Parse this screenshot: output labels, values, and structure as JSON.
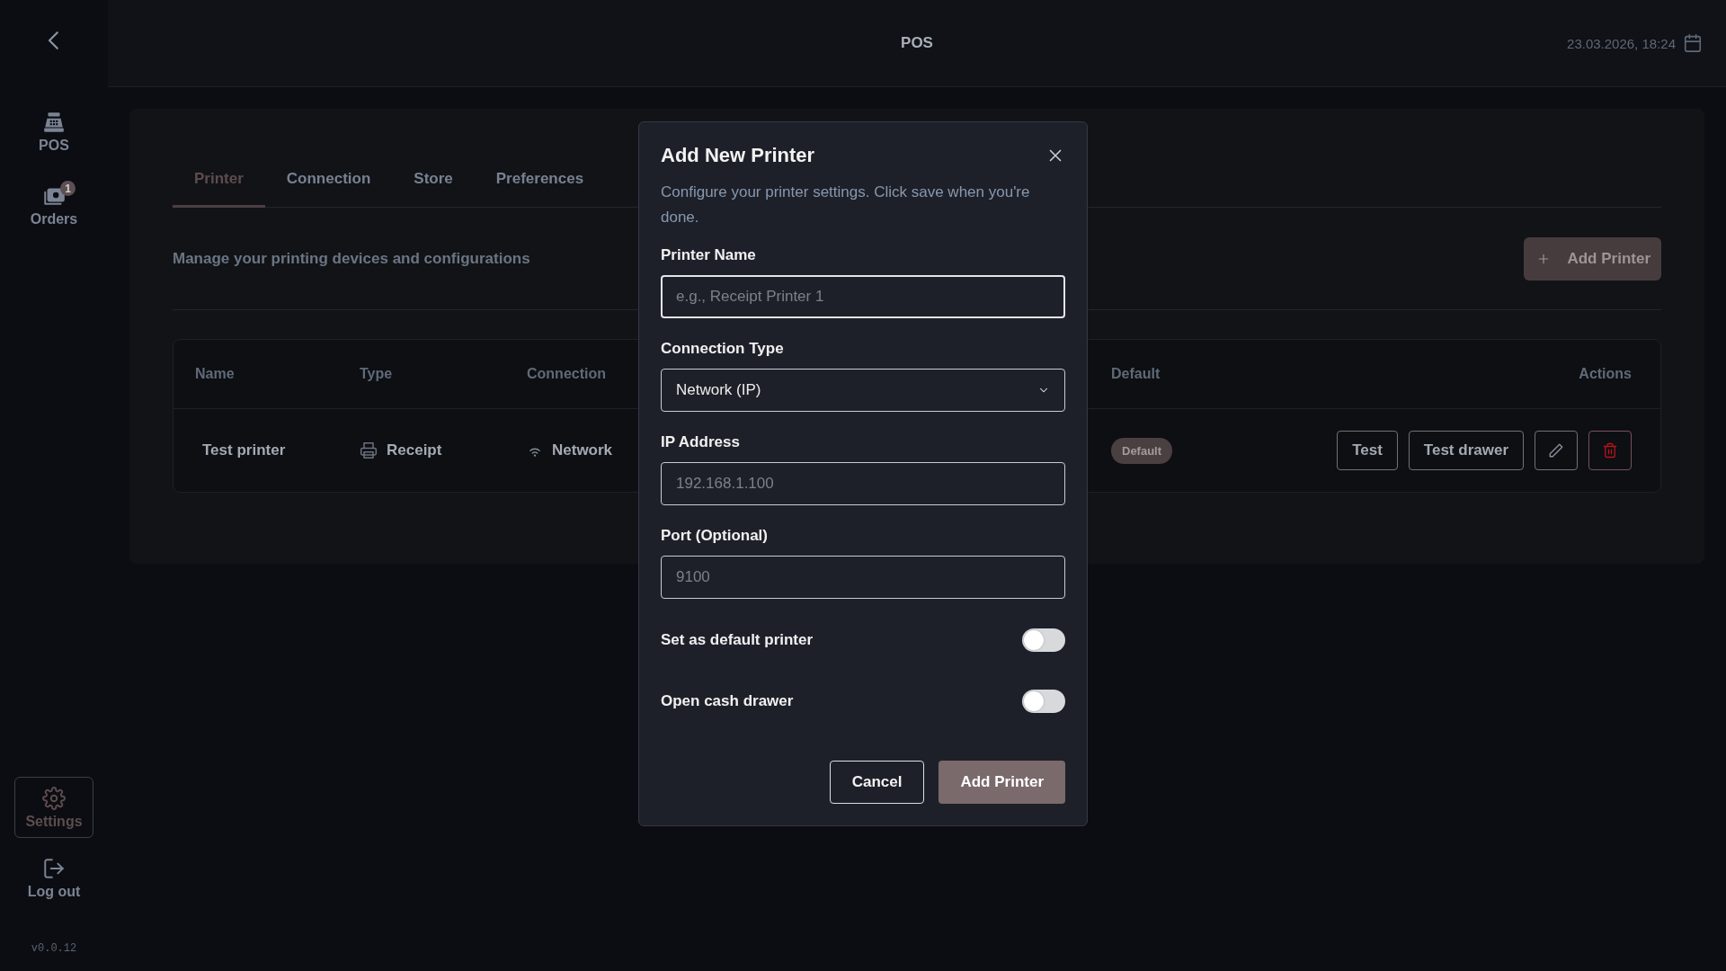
{
  "sidebar": {
    "items": [
      {
        "kind": "pos",
        "label": "POS",
        "selected": false
      },
      {
        "kind": "orders",
        "label": "Orders",
        "badge": "1",
        "selected": false
      }
    ],
    "bottom_items": [
      {
        "kind": "settings",
        "label": "Settings",
        "selected": true
      },
      {
        "kind": "logout",
        "label": "Log out",
        "selected": false
      }
    ],
    "version": "v0.0.12"
  },
  "header": {
    "title": "POS",
    "datetime": "23.03.2026, 18:24"
  },
  "tabs": [
    {
      "label": "Printer",
      "selected": true
    },
    {
      "label": "Connection",
      "selected": false
    },
    {
      "label": "Store",
      "selected": false
    },
    {
      "label": "Preferences",
      "selected": false
    }
  ],
  "description": "Manage your printing devices and configurations",
  "add_button": "Add Printer",
  "table": {
    "columns": [
      "Name",
      "Type",
      "Connection",
      "Default",
      "Actions"
    ],
    "rows": [
      {
        "name": "Test printer",
        "type": "Receipt",
        "connection": "Network",
        "default": "Default",
        "actions": [
          "Test",
          "Test drawer"
        ]
      }
    ]
  },
  "dialog": {
    "title": "Add New Printer",
    "description": "Configure your printer settings. Click save when you're done.",
    "fields": [
      {
        "kind": "text",
        "label": "Printer Name",
        "placeholder": "e.g., Receipt Printer 1",
        "focused": true
      },
      {
        "kind": "select",
        "label": "Connection Type",
        "value": "Network (IP)",
        "focused": false
      },
      {
        "kind": "text",
        "label": "IP Address",
        "placeholder": "192.168.1.100",
        "focused": false
      },
      {
        "kind": "text",
        "label": "Port (Optional)",
        "placeholder": "9100",
        "focused": false
      }
    ],
    "toggles": [
      {
        "label": "Set as default printer",
        "on": false
      },
      {
        "label": "Open cash drawer",
        "on": false
      }
    ],
    "cancel": "Cancel",
    "submit": "Add Printer"
  }
}
